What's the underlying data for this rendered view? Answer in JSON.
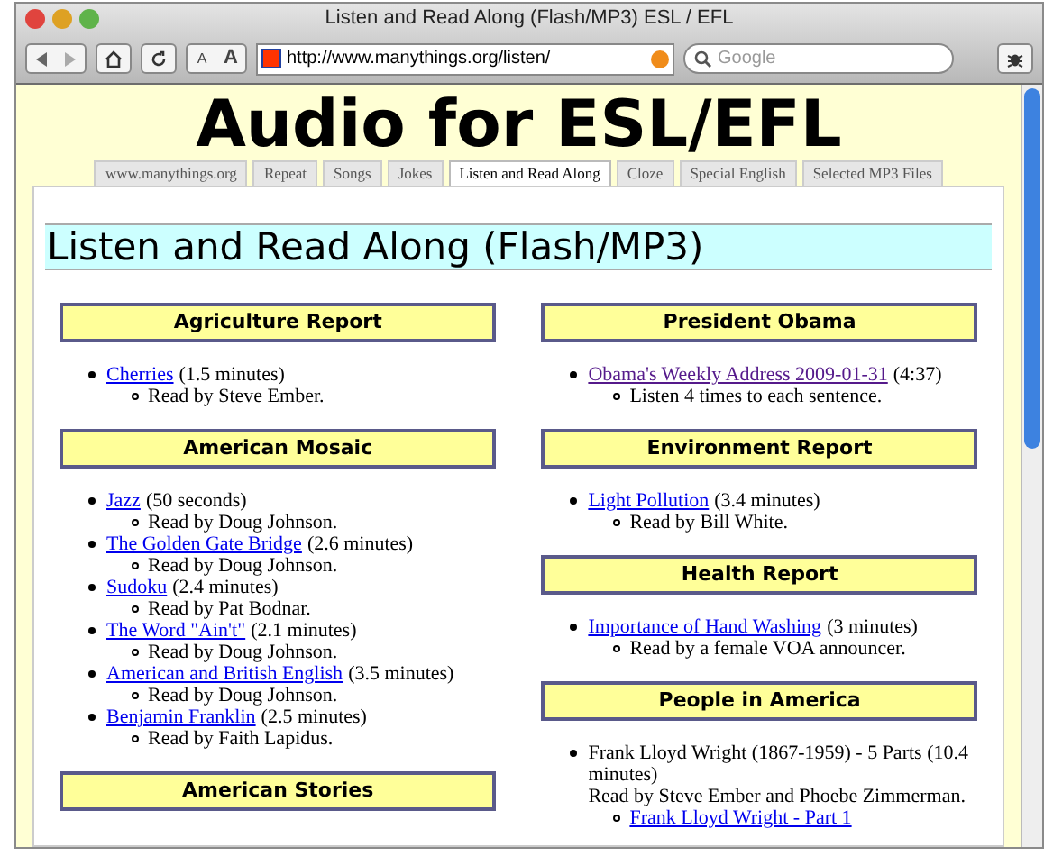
{
  "window": {
    "title": "Listen and Read Along (Flash/MP3) ESL / EFL"
  },
  "toolbar": {
    "url": "http://www.manythings.org/listen/",
    "search": {
      "placeholder": "Google"
    },
    "text_buttons": [
      "A",
      "A"
    ]
  },
  "page": {
    "title": "Audio for ESL/EFL",
    "tabs": [
      {
        "label": "www.manythings.org",
        "selected": false
      },
      {
        "label": "Repeat",
        "selected": false
      },
      {
        "label": "Songs",
        "selected": false
      },
      {
        "label": "Jokes",
        "selected": false
      },
      {
        "label": "Listen and Read Along",
        "selected": true
      },
      {
        "label": "Cloze",
        "selected": false
      },
      {
        "label": "Special English",
        "selected": false
      },
      {
        "label": "Selected MP3 Files",
        "selected": false
      }
    ],
    "heading": "Listen and Read Along (Flash/MP3)",
    "columns": [
      [
        {
          "heading": "Agriculture Report",
          "items": [
            {
              "kind": "link",
              "link": "Cherries",
              "visited": false,
              "note": "(1.5 minutes)",
              "sub": [
                {
                  "kind": "text",
                  "text": "Read by Steve Ember."
                }
              ]
            }
          ]
        },
        {
          "heading": "American Mosaic",
          "items": [
            {
              "kind": "link",
              "link": "Jazz",
              "visited": false,
              "note": "(50 seconds)",
              "sub": [
                {
                  "kind": "text",
                  "text": "Read by Doug Johnson."
                }
              ]
            },
            {
              "kind": "link",
              "link": "The Golden Gate Bridge",
              "visited": false,
              "note": "(2.6 minutes)",
              "sub": [
                {
                  "kind": "text",
                  "text": "Read by Doug Johnson."
                }
              ]
            },
            {
              "kind": "link",
              "link": "Sudoku",
              "visited": false,
              "note": "(2.4 minutes)",
              "sub": [
                {
                  "kind": "text",
                  "text": "Read by Pat Bodnar."
                }
              ]
            },
            {
              "kind": "link",
              "link": "The Word \"Ain't\"",
              "visited": false,
              "note": "(2.1 minutes)",
              "sub": [
                {
                  "kind": "text",
                  "text": "Read by Doug Johnson."
                }
              ]
            },
            {
              "kind": "link",
              "link": "American and British English",
              "visited": false,
              "note": "(3.5 minutes)",
              "sub": [
                {
                  "kind": "text",
                  "text": "Read by Doug Johnson."
                }
              ]
            },
            {
              "kind": "link",
              "link": "Benjamin Franklin",
              "visited": false,
              "note": "(2.5 minutes)",
              "sub": [
                {
                  "kind": "text",
                  "text": "Read by Faith Lapidus."
                }
              ]
            }
          ]
        },
        {
          "heading": "American Stories"
        }
      ],
      [
        {
          "heading": "President Obama",
          "items": [
            {
              "kind": "link",
              "link": "Obama's Weekly Address 2009-01-31",
              "visited": true,
              "note": "(4:37)",
              "sub": [
                {
                  "kind": "text",
                  "text": "Listen 4 times to each sentence."
                }
              ]
            }
          ]
        },
        {
          "heading": "Environment Report",
          "items": [
            {
              "kind": "link",
              "link": "Light Pollution",
              "visited": false,
              "note": "(3.4 minutes)",
              "sub": [
                {
                  "kind": "text",
                  "text": "Read by Bill White."
                }
              ]
            }
          ]
        },
        {
          "heading": "Health Report",
          "items": [
            {
              "kind": "link",
              "link": "Importance of Hand Washing",
              "visited": false,
              "note": "(3 minutes)",
              "sub": [
                {
                  "kind": "text",
                  "text": "Read by a female VOA announcer."
                }
              ]
            }
          ]
        },
        {
          "heading": "People in America",
          "items": [
            {
              "kind": "text",
              "text": "Frank Lloyd Wright (1867-1959) - 5 Parts (10.4 minutes)",
              "detail": "Read by Steve Ember and Phoebe Zimmerman.",
              "sub": [
                {
                  "kind": "link",
                  "link": "Frank Lloyd Wright - Part 1",
                  "visited": false
                }
              ]
            }
          ]
        }
      ]
    ]
  }
}
